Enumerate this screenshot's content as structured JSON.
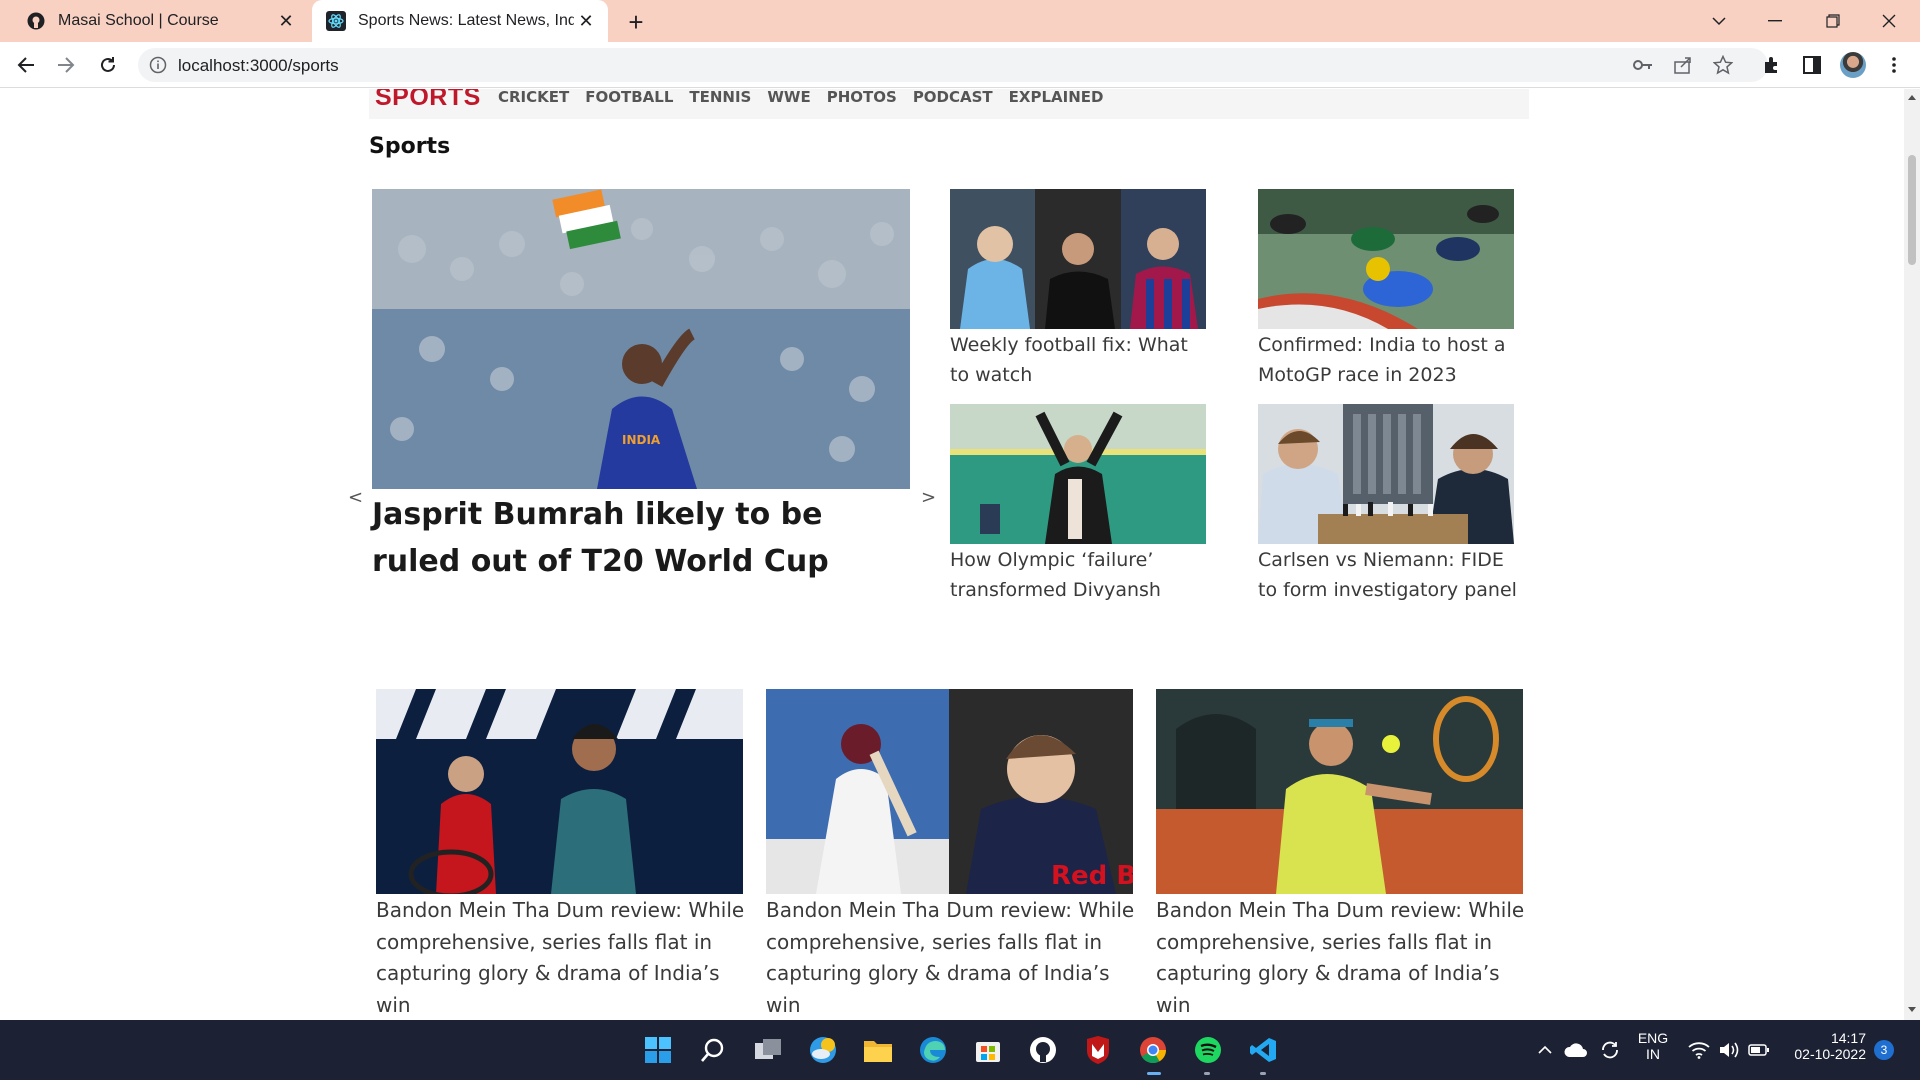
{
  "browser": {
    "tabs": [
      {
        "title": "Masai School | Course",
        "active": false,
        "icon": "github-style-favicon"
      },
      {
        "title": "Sports News: Latest News, India N",
        "active": true,
        "icon": "react-favicon"
      }
    ],
    "url": "localhost:3000/sports"
  },
  "site_nav": {
    "brand": "SPORTS",
    "brand_color": "#c0182b",
    "links": [
      "CRICKET",
      "FOOTBALL",
      "TENNIS",
      "WWE",
      "PHOTOS",
      "PODCAST",
      "EXPLAINED"
    ]
  },
  "section": {
    "heading": "Sports"
  },
  "hero": {
    "title": "Jasprit Bumrah likely to be ruled out of T20 World Cup",
    "prev_arrow": "<",
    "next_arrow": ">"
  },
  "side_cards": [
    {
      "title": "Weekly football fix: What to watch"
    },
    {
      "title": "Confirmed: India to host a MotoGP race in 2023"
    },
    {
      "title": "How Olympic ‘failure’ transformed Divyansh"
    },
    {
      "title": "Carlsen vs Niemann: FIDE to form investigatory panel"
    }
  ],
  "bottom_cards": [
    {
      "title": "Bandon Mein Tha Dum review: While comprehensive, series falls flat in capturing glory & drama of India’s win"
    },
    {
      "title": "Bandon Mein Tha Dum review: While comprehensive, series falls flat in capturing glory & drama of India’s win"
    },
    {
      "title": "Bandon Mein Tha Dum review: While comprehensive, series falls flat in capturing glory & drama of India’s win"
    }
  ],
  "taskbar": {
    "language": "ENG",
    "region": "IN",
    "time": "14:17",
    "date": "02-10-2022",
    "notifications": "3"
  }
}
